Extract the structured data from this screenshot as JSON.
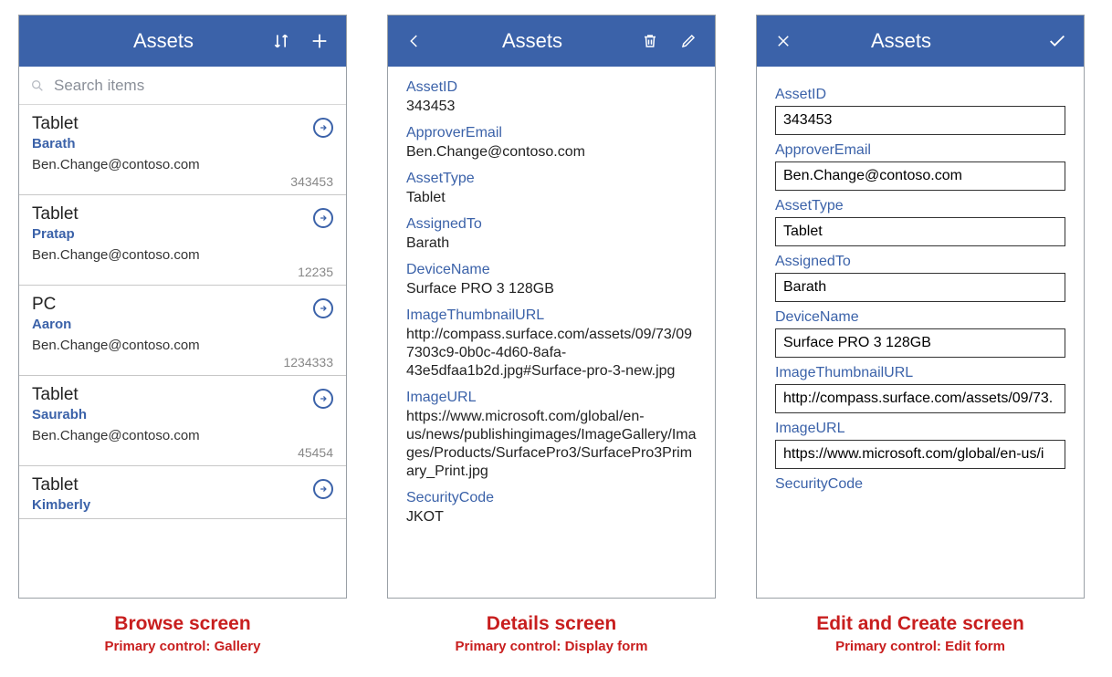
{
  "app_title": "Assets",
  "search_placeholder": "Search items",
  "browse": {
    "caption_title": "Browse screen",
    "caption_sub": "Primary control: Gallery",
    "items": [
      {
        "type": "Tablet",
        "assigned": "Barath",
        "email": "Ben.Change@contoso.com",
        "id": "343453"
      },
      {
        "type": "Tablet",
        "assigned": "Pratap",
        "email": "Ben.Change@contoso.com",
        "id": "12235"
      },
      {
        "type": "PC",
        "assigned": "Aaron",
        "email": "Ben.Change@contoso.com",
        "id": "1234333"
      },
      {
        "type": "Tablet",
        "assigned": "Saurabh",
        "email": "Ben.Change@contoso.com",
        "id": "45454"
      },
      {
        "type": "Tablet",
        "assigned": "Kimberly",
        "email": "",
        "id": ""
      }
    ]
  },
  "details": {
    "caption_title": "Details screen",
    "caption_sub": "Primary control: Display form",
    "fields": {
      "AssetID": "343453",
      "ApproverEmail": "Ben.Change@contoso.com",
      "AssetType": "Tablet",
      "AssignedTo": "Barath",
      "DeviceName": "Surface PRO 3 128GB",
      "ImageThumbnailURL": "http://compass.surface.com/assets/09/73/097303c9-0b0c-4d60-8afa-43e5dfaa1b2d.jpg#Surface-pro-3-new.jpg",
      "ImageURL": "https://www.microsoft.com/global/en-us/news/publishingimages/ImageGallery/Images/Products/SurfacePro3/SurfacePro3Primary_Print.jpg",
      "SecurityCode": "JKOT"
    },
    "labels": {
      "AssetID": "AssetID",
      "ApproverEmail": "ApproverEmail",
      "AssetType": "AssetType",
      "AssignedTo": "AssignedTo",
      "DeviceName": "DeviceName",
      "ImageThumbnailURL": "ImageThumbnailURL",
      "ImageURL": "ImageURL",
      "SecurityCode": "SecurityCode"
    }
  },
  "edit": {
    "caption_title": "Edit and Create screen",
    "caption_sub": "Primary control: Edit form",
    "fields": {
      "AssetID": "343453",
      "ApproverEmail": "Ben.Change@contoso.com",
      "AssetType": "Tablet",
      "AssignedTo": "Barath",
      "DeviceName": "Surface PRO 3 128GB",
      "ImageThumbnailURL": "http://compass.surface.com/assets/09/73.",
      "ImageURL": "https://www.microsoft.com/global/en-us/i",
      "SecurityCode": ""
    }
  }
}
